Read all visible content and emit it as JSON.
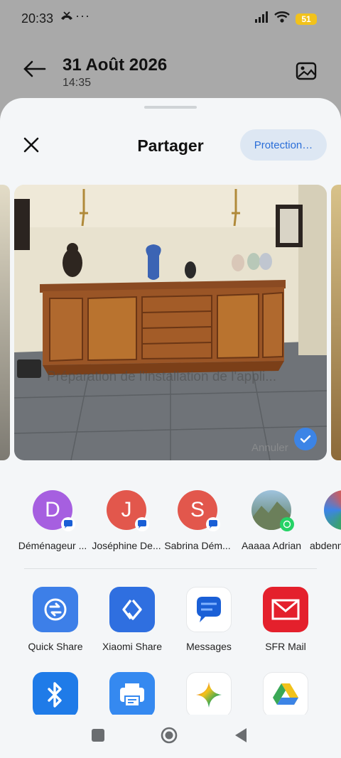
{
  "status_bar": {
    "time": "20:33",
    "extra_icon": "missed-call-icon",
    "dots": "···",
    "battery": "51",
    "battery_color": "#f2c21b"
  },
  "header": {
    "date": "31 Août 2026",
    "time": "14:35"
  },
  "share_sheet": {
    "title": "Partager",
    "protection_label": "Protection…",
    "photo_overlay_text": "Préparation de l'installation de l'appli...",
    "photo_cancel_text": "Annuler",
    "selected": true,
    "accent_color": "#3c84e6"
  },
  "contacts": [
    {
      "name": "Déménageur ...",
      "initial": "D",
      "color": "#a65fe0",
      "badge": "messages-icon"
    },
    {
      "name": "Joséphine De...",
      "initial": "J",
      "color": "#e2574c",
      "badge": "messages-icon"
    },
    {
      "name": "Sabrina Dém...",
      "initial": "S",
      "color": "#e2574c",
      "badge": "messages-icon"
    },
    {
      "name": "Aaaaa Adrian",
      "initial": "",
      "color": "#7d9fb8",
      "badge": "whatsapp-icon"
    },
    {
      "name": "abdenn",
      "initial": "",
      "color": "#3aa856",
      "badge": ""
    }
  ],
  "apps": [
    {
      "label": "Quick Share",
      "icon": "quick-share-icon",
      "color": "#3d7fe8"
    },
    {
      "label": "Xiaomi Share",
      "icon": "xiaomi-share-icon",
      "color": "#2f6fe0"
    },
    {
      "label": "Messages",
      "icon": "messages-icon",
      "color": "#1a5fd6"
    },
    {
      "label": "SFR Mail",
      "icon": "mail-icon",
      "color": "#e4202c"
    },
    {
      "label": "",
      "icon": "bluetooth-icon",
      "color": "#1f7be8"
    },
    {
      "label": "",
      "icon": "print-icon",
      "color": "#3589f0"
    },
    {
      "label": "",
      "icon": "gemini-icon",
      "color": "#ffffff"
    },
    {
      "label": "",
      "icon": "google-drive-icon",
      "color": "#ffffff"
    }
  ],
  "nav": {
    "recents": "recents-icon",
    "home": "home-icon",
    "back": "back-icon"
  }
}
